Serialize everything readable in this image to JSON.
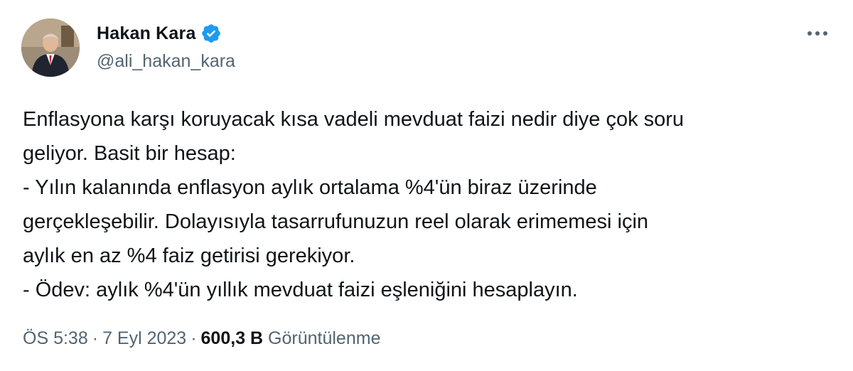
{
  "author": {
    "display_name": "Hakan Kara",
    "handle": "@ali_hakan_kara",
    "verified": true
  },
  "tweet": {
    "lines": [
      "Enflasyona karşı koruyacak kısa vadeli mevduat faizi nedir diye çok soru",
      "geliyor. Basit bir hesap:",
      "- Yılın kalanında enflasyon aylık ortalama %4'ün biraz üzerinde",
      "gerçekleşebilir. Dolayısıyla tasarrufunuzun reel olarak erimemesi için",
      "aylık en az %4 faiz getirisi gerekiyor.",
      "- Ödev: aylık %4'ün yıllık mevduat faizi eşleniğini hesaplayın."
    ]
  },
  "meta": {
    "time": "ÖS 5:38",
    "date": "7 Eyl 2023",
    "separator": "·",
    "views_count": "600,3 B",
    "views_label": "Görüntülenme"
  },
  "icons": {
    "verified": "verified-badge-icon",
    "more": "more-options-icon"
  },
  "colors": {
    "verified_blue": "#1d9bf0",
    "secondary_text": "#536471",
    "primary_text": "#0f1419"
  }
}
